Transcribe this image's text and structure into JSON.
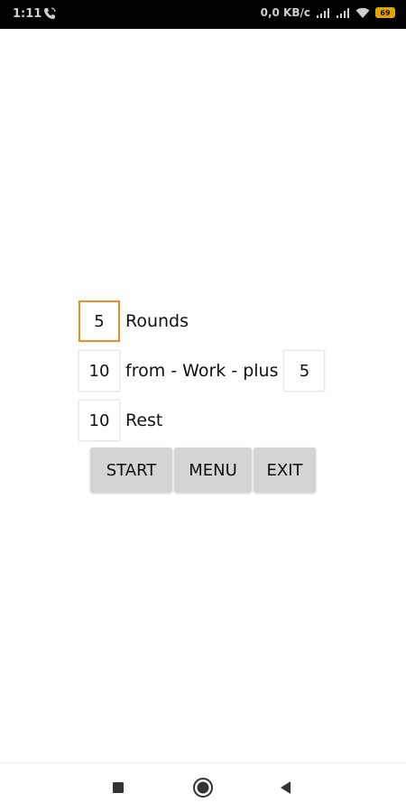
{
  "status_bar": {
    "time": "1:11",
    "network_speed": "0,0 KB/c",
    "battery_level": "69",
    "icons": [
      "phone-call-icon",
      "signal-icon",
      "signal-icon",
      "wifi-icon",
      "battery-icon"
    ]
  },
  "form": {
    "rounds_value": "5",
    "rounds_label": "Rounds",
    "work_value": "10",
    "work_label": "from - Work - plus",
    "work_plus_value": "5",
    "rest_value": "10",
    "rest_label": "Rest"
  },
  "buttons": {
    "start": "START",
    "menu": "MENU",
    "exit": "EXIT"
  },
  "nav_bar": {
    "icons": [
      "recents-square-icon",
      "home-circle-icon",
      "back-triangle-icon"
    ]
  },
  "colors": {
    "focus_accent": "#f28c1e",
    "button_bg": "#d4d4d4",
    "status_bg": "#000000",
    "battery": "#e2a400"
  }
}
